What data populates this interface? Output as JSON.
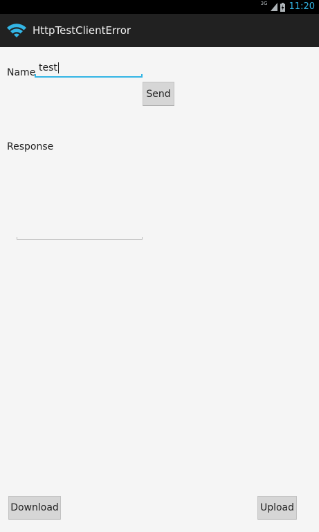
{
  "status_bar": {
    "network": "3G",
    "time": "11:20",
    "accent_color": "#33b5e5"
  },
  "action_bar": {
    "icon": "wifi-icon",
    "title": "HttpTestClientError"
  },
  "form": {
    "name_label": "Name",
    "name_value": "test",
    "send_label": "Send",
    "response_label": "Response",
    "response_value": ""
  },
  "footer": {
    "download_label": "Download",
    "upload_label": "Upload"
  }
}
